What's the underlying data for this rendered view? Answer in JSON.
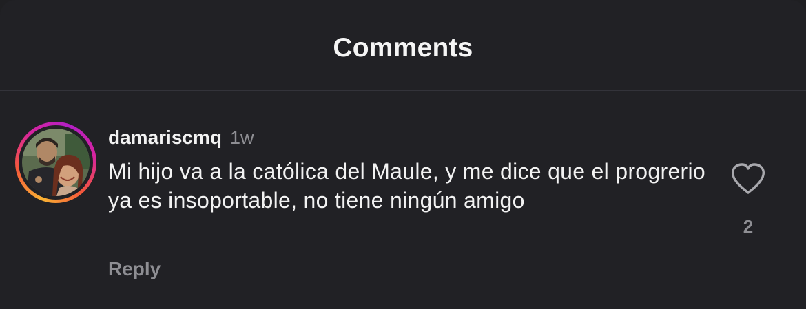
{
  "header": {
    "title": "Comments"
  },
  "comment": {
    "username": "damariscmq",
    "timestamp": "1w",
    "text": "Mi hijo va a la católica del Maule, y me dice que el progrerio ya es insoportable, no tiene ningún amigo",
    "reply_label": "Reply",
    "like_count": "2",
    "like_icon": "heart-outline-icon",
    "avatar_ring_colors": [
      "#f9b233",
      "#f5593a",
      "#d6249f",
      "#b31fc6"
    ]
  }
}
